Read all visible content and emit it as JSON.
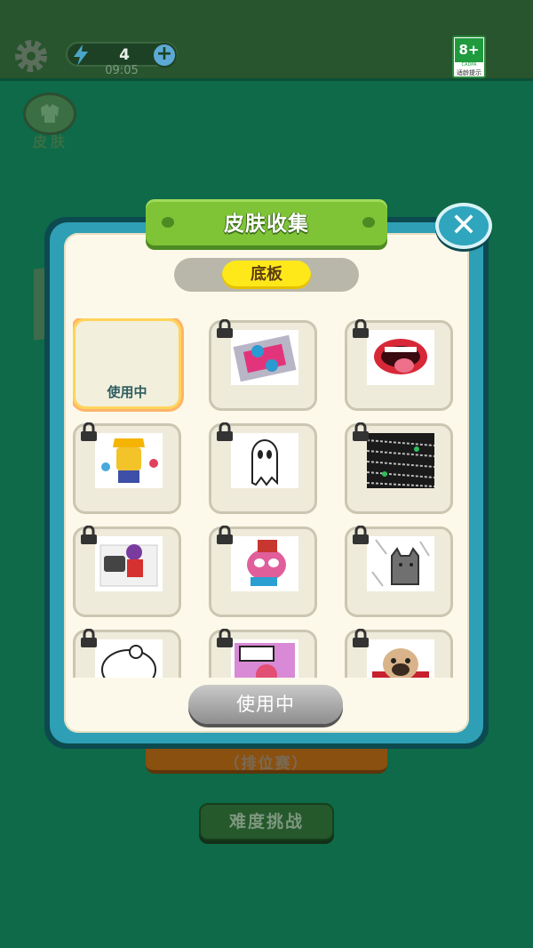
{
  "status": {
    "energy": "4",
    "timer": "09:05",
    "age_rating": "8+",
    "age_org": "CADPA",
    "age_hint": "适龄提示"
  },
  "side": {
    "skin_label": "皮肤"
  },
  "background_buttons": {
    "rank": "（排位赛）",
    "difficulty": "难度挑战"
  },
  "dialog": {
    "title": "皮肤收集",
    "tab": "底板",
    "active_label": "使用中",
    "use_button": "使用中",
    "items": [
      {
        "name": "default",
        "locked": false
      },
      {
        "name": "casio-graffiti",
        "locked": true
      },
      {
        "name": "mouth-tongue",
        "locked": true
      },
      {
        "name": "yellow-king",
        "locked": true
      },
      {
        "name": "ghost",
        "locked": true
      },
      {
        "name": "text-pattern",
        "locked": true
      },
      {
        "name": "boombox-guy",
        "locked": true
      },
      {
        "name": "pink-monster",
        "locked": true
      },
      {
        "name": "grey-cat",
        "locked": true
      },
      {
        "name": "sketch-cat",
        "locked": true
      },
      {
        "name": "art-graffiti",
        "locked": true
      },
      {
        "name": "pug",
        "locked": true
      }
    ]
  },
  "colors": {
    "background": "#0e6a48",
    "ribbon": "#7fc437",
    "frame": "#2e9fb4",
    "tab_active": "#ffe81a"
  }
}
